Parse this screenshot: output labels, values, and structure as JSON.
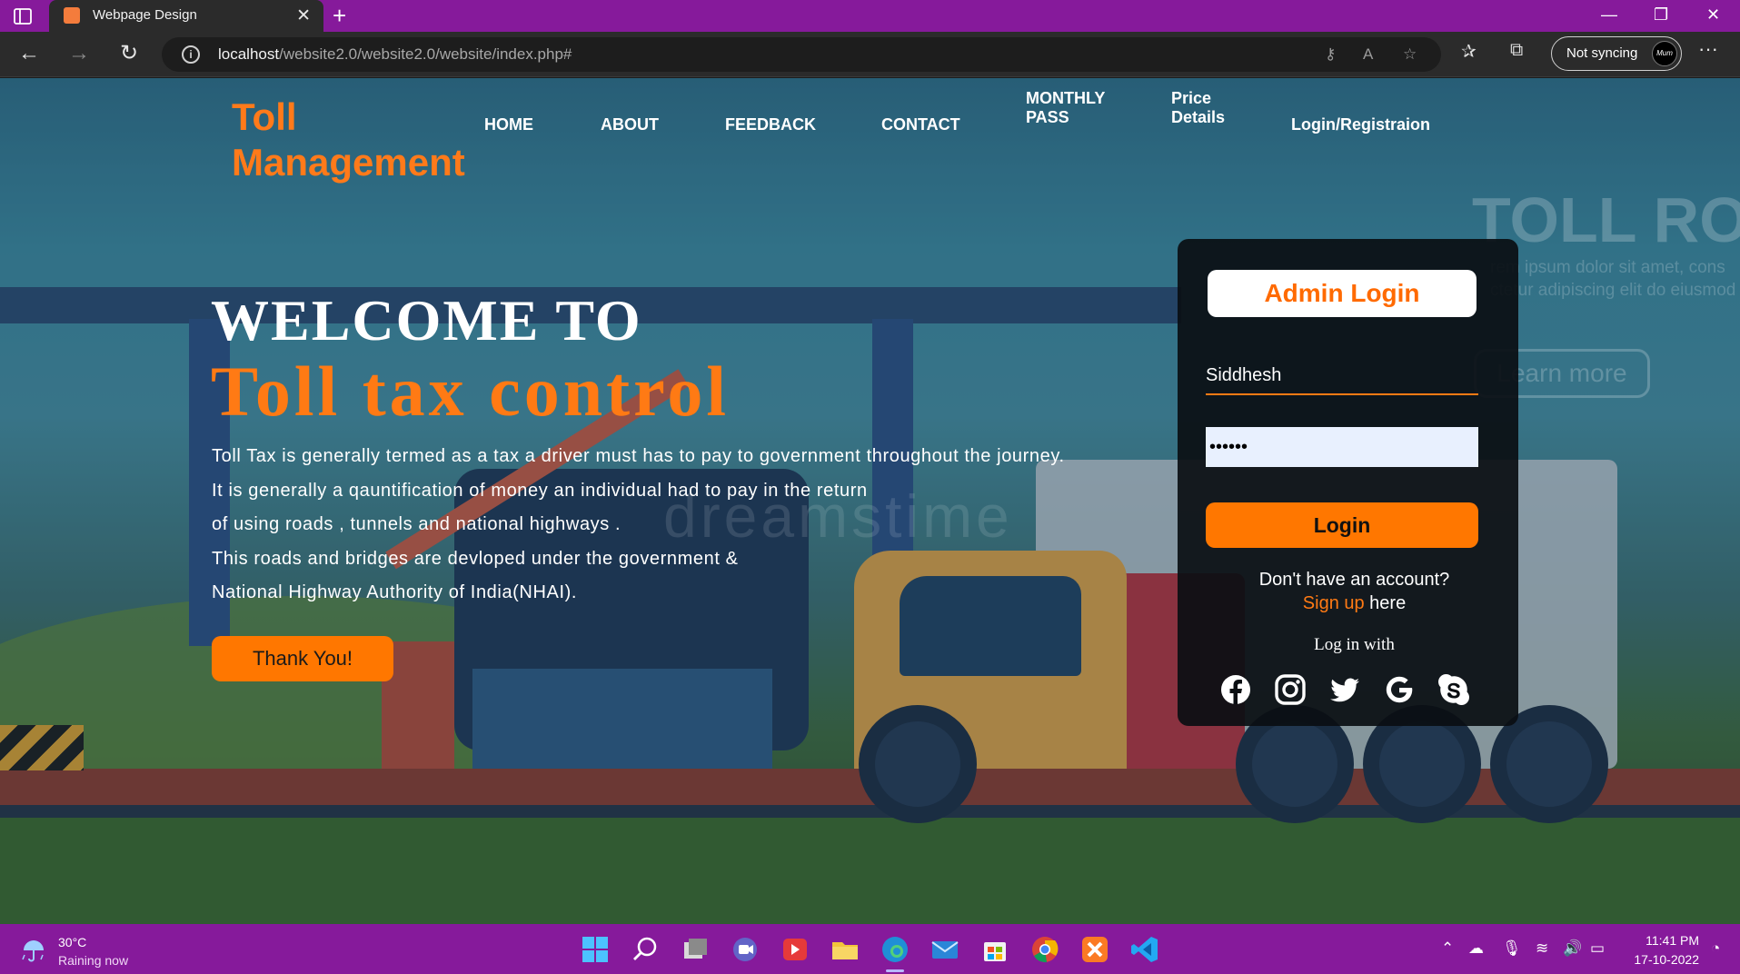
{
  "browser": {
    "tab_title": "Webpage Design",
    "url_host": "localhost",
    "url_path": "/website2.0/website2.0/website/index.php#",
    "sync_label": "Not syncing",
    "avatar_text": "Mum"
  },
  "site": {
    "logo_line1": "Toll",
    "logo_line2": "Management",
    "nav": {
      "home": "HOME",
      "about": "ABOUT",
      "feedback": "FEEDBACK",
      "contact": "CONTACT",
      "monthly_1": "MONTHLY",
      "monthly_2": "PASS",
      "price_1": "Price",
      "price_2": "Details",
      "login": "Login/Registraion"
    }
  },
  "hero": {
    "welcome": "WELCOME TO",
    "headline": "Toll tax control",
    "desc_lines": [
      "Toll Tax is generally termed as a tax a driver must has to pay to government throughout the journey.",
      "It is generally a qauntification of money an individual had to pay in the return",
      "of using roads , tunnels and national highways .",
      "This roads and bridges are devloped under the government &",
      "National Highway Authority of India(NHAI)."
    ],
    "cta_label": "Thank You!"
  },
  "background": {
    "ghost_title": "TOLL RO",
    "ghost_line1": "rem ipsum dolor sit amet, cons",
    "ghost_line2": "ctetur adipiscing elit do eiusmod tempo",
    "ghost_button": "Learn more",
    "watermark": "dreamstime"
  },
  "login": {
    "title": "Admin Login",
    "username_value": "Siddhesh",
    "password_value": "••••••",
    "button_label": "Login",
    "account_question": "Don't have an account?",
    "signup_link": "Sign up",
    "signup_suffix": " here",
    "log_in_with": "Log in with",
    "socials": [
      "facebook-icon",
      "instagram-icon",
      "twitter-icon",
      "google-icon",
      "skype-icon"
    ]
  },
  "taskbar": {
    "temperature": "30°C",
    "weather": "Raining now",
    "time": "11:41 PM",
    "date": "17-10-2022"
  },
  "colors": {
    "accent": "#ff7a14",
    "tabbar": "#861a9b",
    "login_card": "#0a0e12"
  }
}
